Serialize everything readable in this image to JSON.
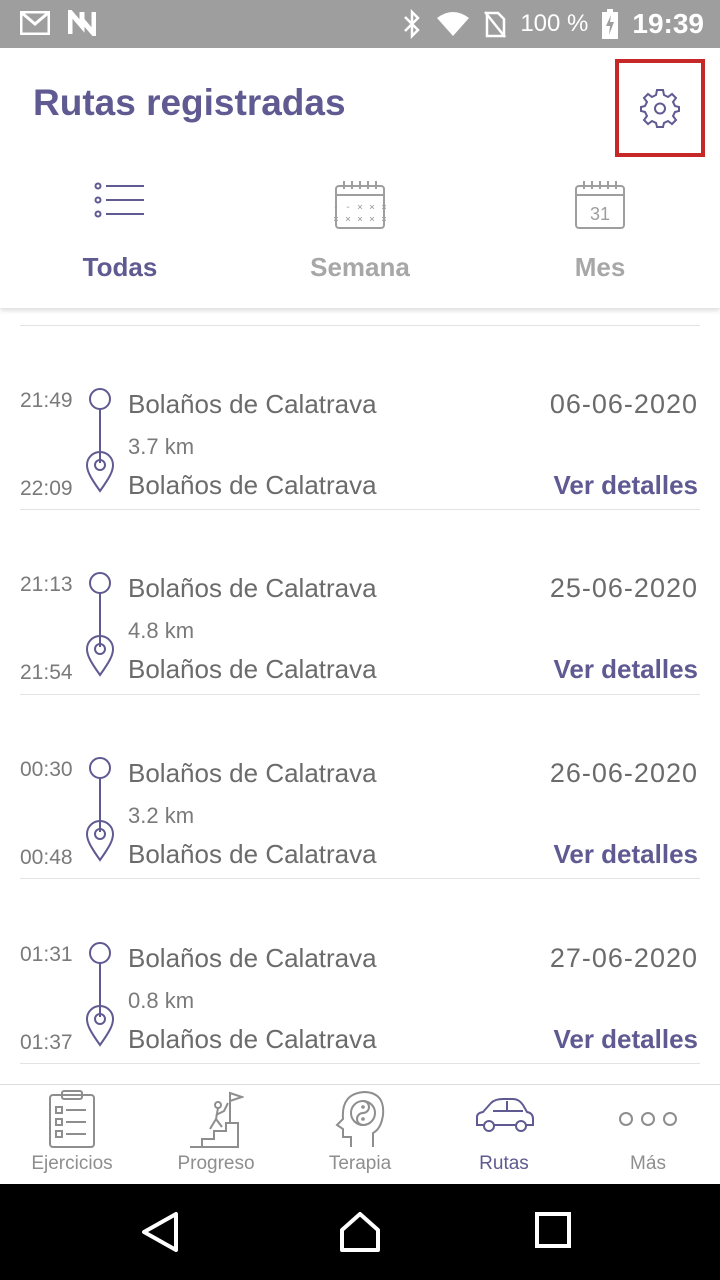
{
  "status_bar": {
    "battery": "100 %",
    "time": "19:39",
    "icons": [
      "gmail-icon",
      "n-icon",
      "bluetooth-icon",
      "wifi-icon",
      "no-sim-icon",
      "battery-charging-icon"
    ]
  },
  "header": {
    "title": "Rutas registradas",
    "settings_icon": "gear-icon"
  },
  "tabs": [
    {
      "label": "Todas",
      "icon": "list-icon",
      "active": true
    },
    {
      "label": "Semana",
      "icon": "calendar-week-icon",
      "active": false
    },
    {
      "label": "Mes",
      "icon": "calendar-month-icon",
      "icon_text": "31",
      "active": false
    }
  ],
  "routes": [
    {
      "start_time": "21:49",
      "end_time": "22:09",
      "start_place": "Bolaños de Calatrava",
      "end_place": "Bolaños de Calatrava",
      "distance": "3.7 km",
      "date": "06-06-2020",
      "details_label": "Ver detalles"
    },
    {
      "start_time": "21:13",
      "end_time": "21:54",
      "start_place": "Bolaños de Calatrava",
      "end_place": "Bolaños de Calatrava",
      "distance": "4.8 km",
      "date": "25-06-2020",
      "details_label": "Ver detalles"
    },
    {
      "start_time": "00:30",
      "end_time": "00:48",
      "start_place": "Bolaños de Calatrava",
      "end_place": "Bolaños de Calatrava",
      "distance": "3.2 km",
      "date": "26-06-2020",
      "details_label": "Ver detalles"
    },
    {
      "start_time": "01:31",
      "end_time": "01:37",
      "start_place": "Bolaños de Calatrava",
      "end_place": "Bolaños de Calatrava",
      "distance": "0.8 km",
      "date": "27-06-2020",
      "details_label": "Ver detalles"
    }
  ],
  "bottom_nav": [
    {
      "label": "Ejercicios",
      "icon": "clipboard-checklist-icon",
      "active": false
    },
    {
      "label": "Progreso",
      "icon": "climber-stairs-flag-icon",
      "active": false
    },
    {
      "label": "Terapia",
      "icon": "head-yin-yang-icon",
      "active": false
    },
    {
      "label": "Rutas",
      "icon": "car-icon",
      "active": true
    },
    {
      "label": "Más",
      "icon": "more-dots-icon",
      "active": false
    }
  ],
  "colors": {
    "accent": "#5f5a91",
    "inactive": "#a7a7a7",
    "text": "#6b6b6b",
    "status_bar": "#9e9e9e",
    "highlight_box": "#c62828"
  }
}
